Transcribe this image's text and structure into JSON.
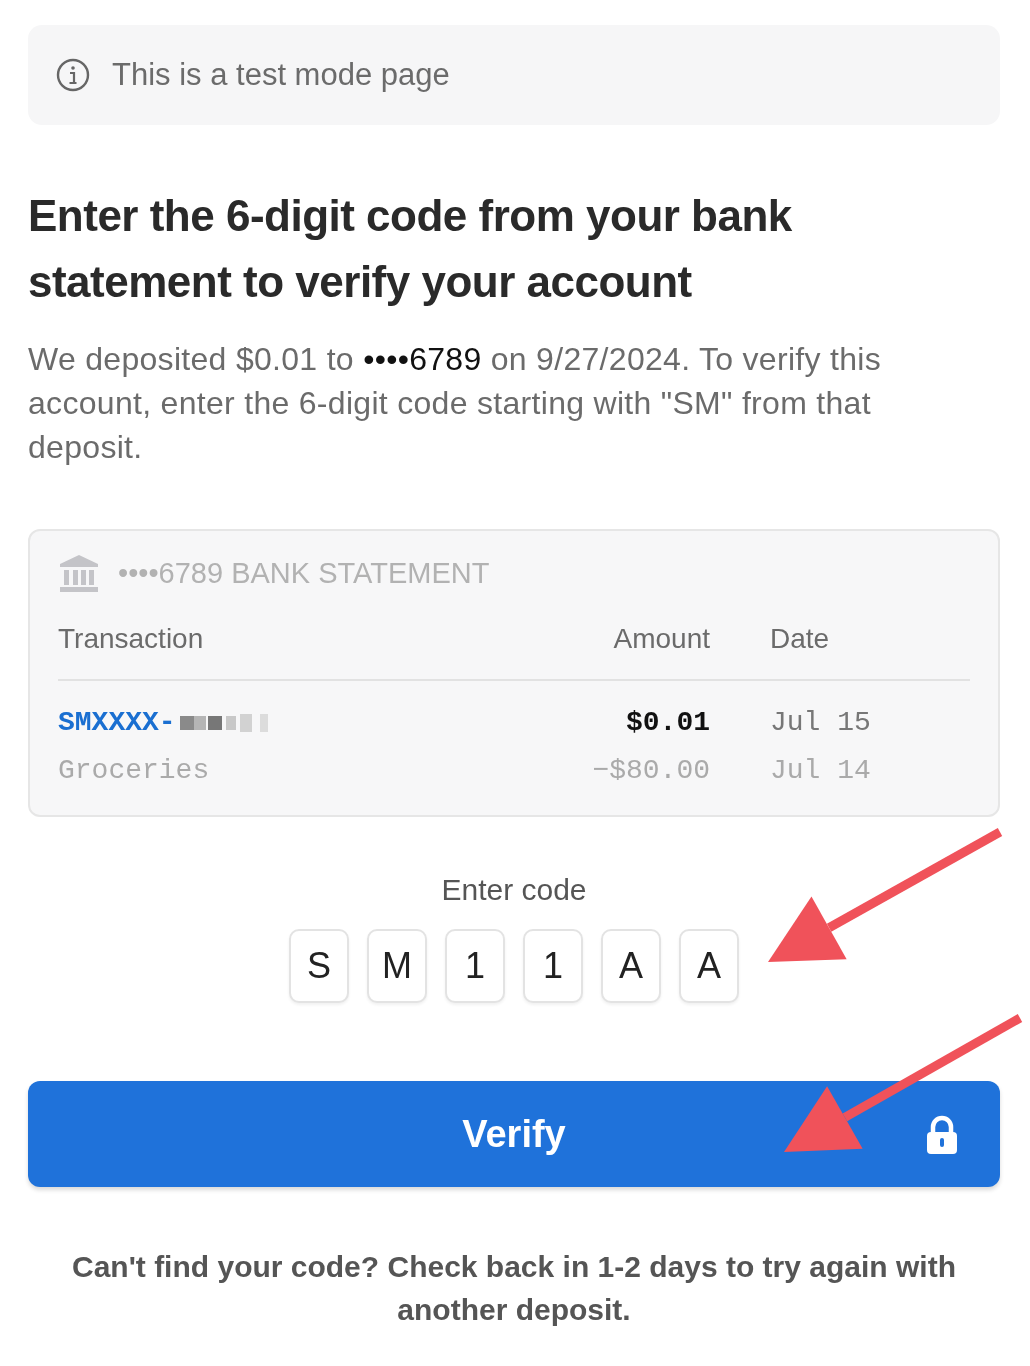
{
  "banner": {
    "text": "This is a test mode page"
  },
  "heading": "Enter the 6-digit code from your bank statement to verify your account",
  "description": {
    "before": "We deposited $0.01 to ",
    "account": "••••6789",
    "after": " on 9/27/2024. To verify this account, enter the 6-digit code starting with \"SM\" from that deposit."
  },
  "statement": {
    "title": "••••6789 BANK STATEMENT",
    "columns": [
      "Transaction",
      "Amount",
      "Date"
    ],
    "rows": [
      {
        "kind": "highlight",
        "transaction": "SMXXXX-",
        "redacted": true,
        "amount": "$0.01",
        "date": "Jul 15"
      },
      {
        "kind": "muted",
        "transaction": "Groceries",
        "redacted": false,
        "amount": "−$80.00",
        "date": "Jul 14"
      }
    ]
  },
  "code": {
    "label": "Enter code",
    "digits": [
      "S",
      "M",
      "1",
      "1",
      "A",
      "A"
    ]
  },
  "verify_button": {
    "label": "Verify"
  },
  "footer": "Can't find your code? Check back in 1-2 days to try again with another deposit.",
  "annotation_arrows": [
    {
      "kind": "arrow"
    },
    {
      "kind": "arrow"
    }
  ]
}
